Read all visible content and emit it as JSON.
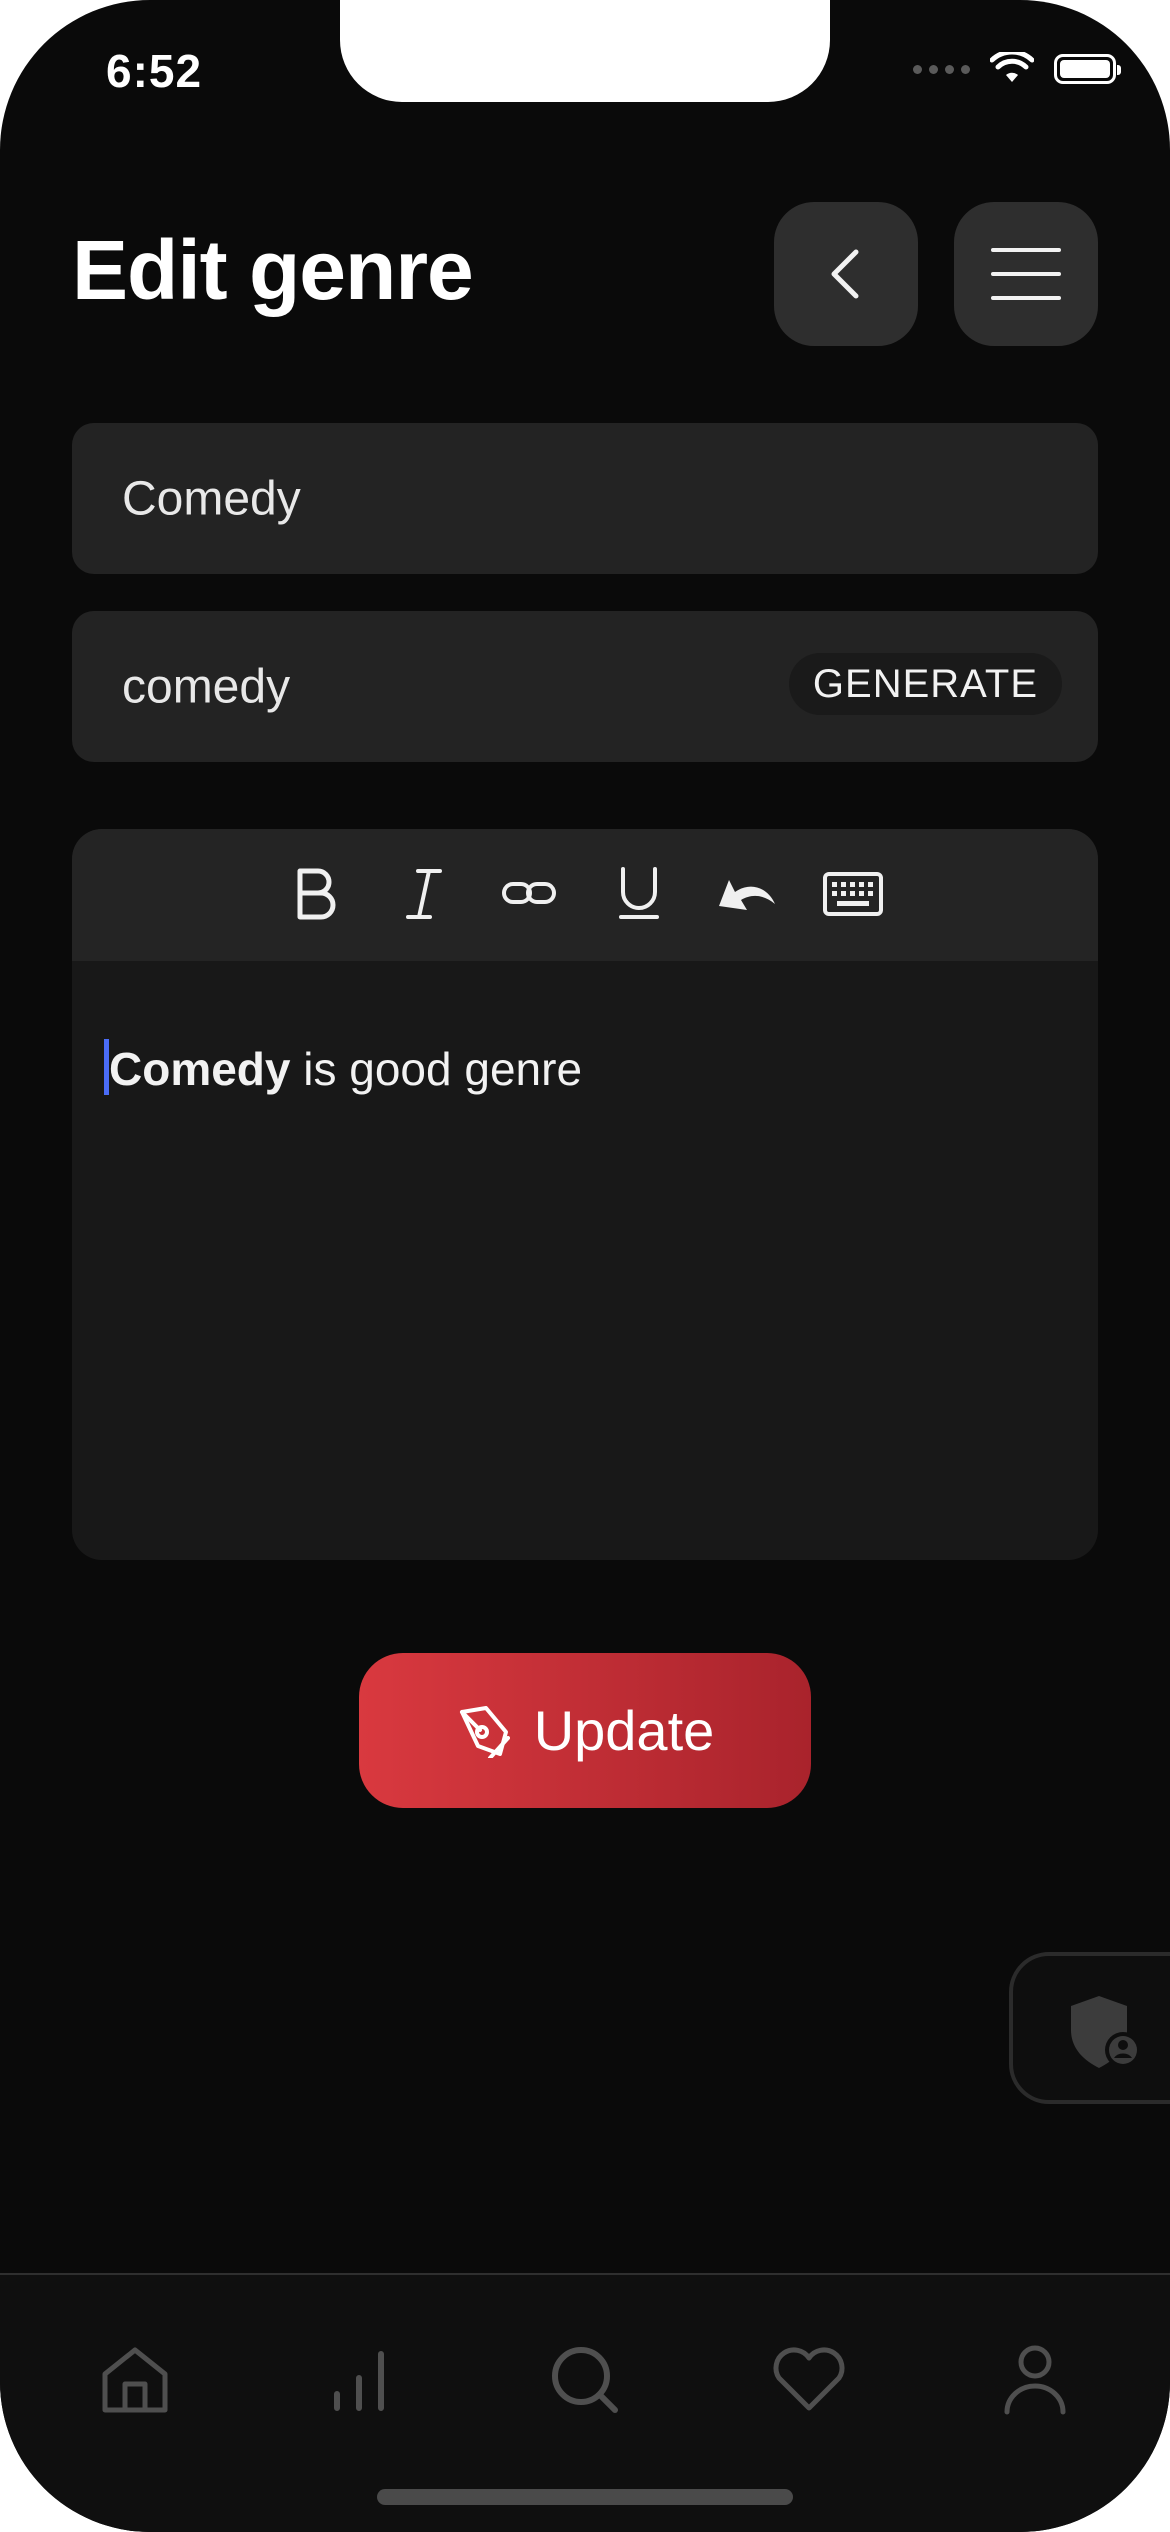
{
  "status_bar": {
    "time": "6:52",
    "icons": [
      "cellular-dots-icon",
      "wifi-icon",
      "battery-icon"
    ]
  },
  "header": {
    "title": "Edit genre",
    "back_icon": "chevron-left-icon",
    "menu_icon": "hamburger-menu-icon"
  },
  "form": {
    "name_value": "Comedy",
    "slug_value": "comedy",
    "generate_label": "GENERATE"
  },
  "editor": {
    "toolbar": [
      "bold-icon",
      "italic-icon",
      "link-icon",
      "underline-icon",
      "undo-icon",
      "keyboard-icon"
    ],
    "content_bold": "Comedy",
    "content_rest": " is good genre"
  },
  "actions": {
    "update_label": "Update",
    "update_icon": "pen-tool-icon",
    "accent_gradient": [
      "#d9393f",
      "#a9232c"
    ]
  },
  "floating": {
    "icon": "shield-user-icon"
  },
  "tabbar": {
    "items": [
      "home-icon",
      "stats-icon",
      "search-icon",
      "heart-icon",
      "profile-icon"
    ]
  },
  "colors": {
    "background": "#0a0a0a",
    "surface": "#232323",
    "caret": "#4a6cf7"
  }
}
